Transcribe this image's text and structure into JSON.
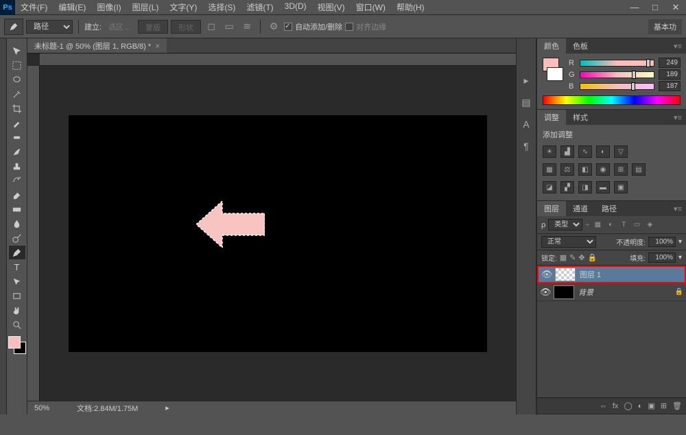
{
  "menu": {
    "file": "文件(F)",
    "edit": "编辑(E)",
    "image": "图像(I)",
    "layer": "图层(L)",
    "type": "文字(Y)",
    "select": "选择(S)",
    "filter": "滤镜(T)",
    "threed": "3D(D)",
    "view": "视图(V)",
    "window": "窗口(W)",
    "help": "帮助(H)"
  },
  "options": {
    "mode": "路径",
    "build_label": "建立:",
    "selection": "选区…",
    "mask": "蒙版",
    "shape": "形状",
    "auto_add_delete": "自动添加/删除",
    "align_edges": "对齐边缘",
    "workspace": "基本功"
  },
  "doc": {
    "tab_title": "未标题-1 @ 50% (图层 1, RGB/8) *",
    "zoom": "50%",
    "doc_size": "文档:2.84M/1.75M"
  },
  "color": {
    "tab_color": "颜色",
    "tab_swatches": "色板",
    "r_label": "R",
    "g_label": "G",
    "b_label": "B",
    "r": "249",
    "g": "189",
    "b": "187",
    "fg": "#f9bdbb",
    "bg": "#000000"
  },
  "adjust": {
    "tab_adjust": "调整",
    "tab_styles": "样式",
    "label": "添加调整"
  },
  "layers": {
    "tab_layers": "图层",
    "tab_channels": "通道",
    "tab_paths": "路径",
    "kind": "类型",
    "blend": "正常",
    "opacity_label": "不透明度:",
    "opacity": "100%",
    "lock_label": "锁定:",
    "fill_label": "填充:",
    "fill": "100%",
    "items": [
      {
        "name": "图层 1",
        "selected": true,
        "thumb": "checker"
      },
      {
        "name": "背景",
        "selected": false,
        "thumb": "black",
        "locked": true,
        "italic": true
      }
    ]
  }
}
